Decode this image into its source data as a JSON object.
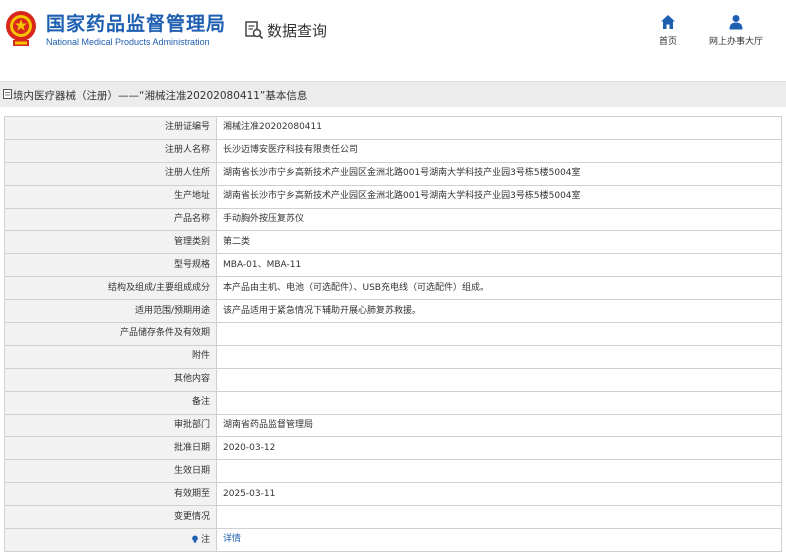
{
  "header": {
    "site_name": "国家药品监督管理局",
    "site_name_en": "National Medical Products Administration",
    "query_label": "数据查询",
    "nav": [
      {
        "label": "首页",
        "icon": "home-icon"
      },
      {
        "label": "网上办事大厅",
        "icon": "user-icon"
      }
    ]
  },
  "breadcrumb": {
    "text": "境内医疗器械（注册）——“湘械注准20202080411”基本信息"
  },
  "colors": {
    "brand": "#1f5fb1",
    "key_bg": "#f2f2f2",
    "border": "#d0d0d0"
  },
  "rows": [
    {
      "key": "注册证编号",
      "value": "湘械注准20202080411"
    },
    {
      "key": "注册人名称",
      "value": "长沙迈博安医疗科技有限责任公司"
    },
    {
      "key": "注册人住所",
      "value": "湖南省长沙市宁乡高新技术产业园区金洲北路001号湖南大学科技产业园3号栋5楼5004室"
    },
    {
      "key": "生产地址",
      "value": "湖南省长沙市宁乡高新技术产业园区金洲北路001号湖南大学科技产业园3号栋5楼5004室"
    },
    {
      "key": "产品名称",
      "value": "手动胸外按压复苏仪"
    },
    {
      "key": "管理类别",
      "value": "第二类"
    },
    {
      "key": "型号规格",
      "value": "MBA-01、MBA-11"
    },
    {
      "key": "结构及组成/主要组成成分",
      "value": "本产品由主机、电池（可选配件）、USB充电线（可选配件）组成。"
    },
    {
      "key": "适用范围/预期用途",
      "value": "该产品适用于紧急情况下辅助开展心肺复苏救援。"
    },
    {
      "key": "产品储存条件及有效期",
      "value": ""
    },
    {
      "key": "附件",
      "value": ""
    },
    {
      "key": "其他内容",
      "value": ""
    },
    {
      "key": "备注",
      "value": ""
    },
    {
      "key": "审批部门",
      "value": "湖南省药品监督管理局"
    },
    {
      "key": "批准日期",
      "value": "2020-03-12"
    },
    {
      "key": "生效日期",
      "value": ""
    },
    {
      "key": "有效期至",
      "value": "2025-03-11"
    },
    {
      "key": "变更情况",
      "value": ""
    }
  ],
  "note_row": {
    "key": "注",
    "link": "详情",
    "icon": "bulb-icon"
  }
}
